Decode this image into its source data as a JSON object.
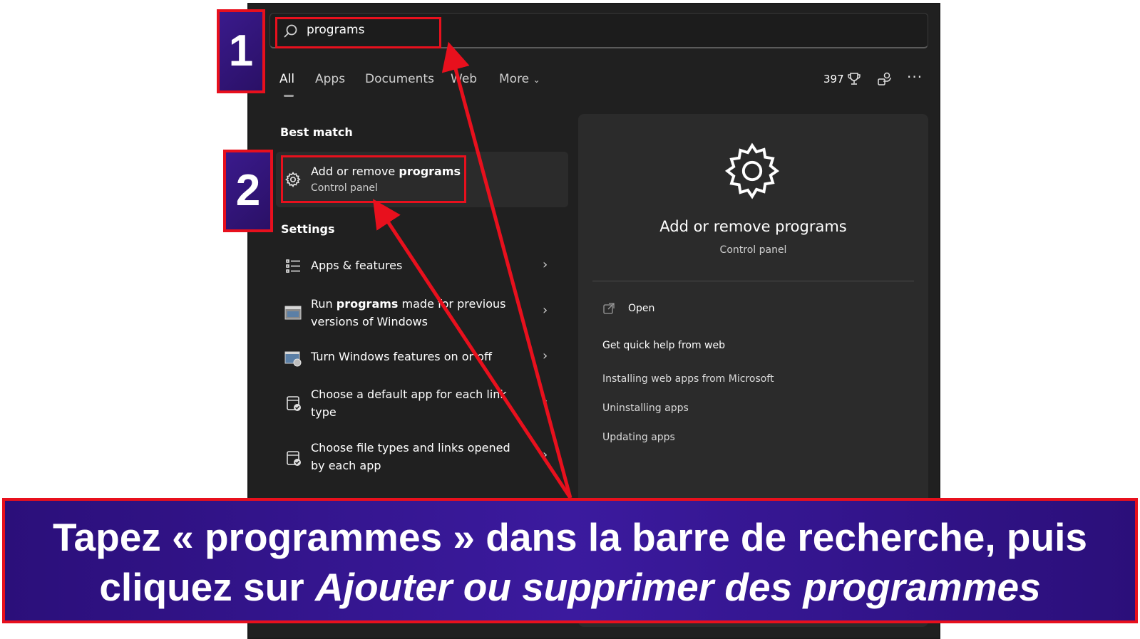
{
  "search": {
    "value": "programs"
  },
  "tabs": [
    {
      "label": "All"
    },
    {
      "label": "Apps"
    },
    {
      "label": "Documents"
    },
    {
      "label": "Web"
    },
    {
      "label": "More"
    }
  ],
  "header_right": {
    "points": "397"
  },
  "best_match": {
    "section_label": "Best match",
    "title_prefix": "Add or remove ",
    "title_bold": "programs",
    "subtitle": "Control panel"
  },
  "settings": {
    "section_label": "Settings",
    "items": [
      {
        "line1_pre": "Apps & features",
        "line1_bold": "",
        "line1_post": "",
        "line2": ""
      },
      {
        "line1_pre": "Run ",
        "line1_bold": "programs",
        "line1_post": " made for previous",
        "line2": "versions of Windows"
      },
      {
        "line1_pre": "Turn Windows features on or off",
        "line1_bold": "",
        "line1_post": "",
        "line2": ""
      },
      {
        "line1_pre": "Choose a default app for each link",
        "line1_bold": "",
        "line1_post": "",
        "line2": "type"
      },
      {
        "line1_pre": "Choose file types and links opened",
        "line1_bold": "",
        "line1_post": "",
        "line2": "by each app"
      }
    ]
  },
  "preview": {
    "title": "Add or remove programs",
    "subtitle": "Control panel",
    "open_label": "Open",
    "help_heading": "Get quick help from web",
    "links": [
      "Installing web apps from Microsoft",
      "Uninstalling apps",
      "Updating apps"
    ]
  },
  "steps": [
    "1",
    "2"
  ],
  "banner": {
    "line1": "Tapez « programmes » dans la barre de recherche, puis",
    "line2_plain": "cliquez sur ",
    "line2_italic": "Ajouter ou supprimer des programmes"
  },
  "colors": {
    "highlight": "#e8101d",
    "banner": "#3b1a9e",
    "window_bg": "#202020"
  }
}
